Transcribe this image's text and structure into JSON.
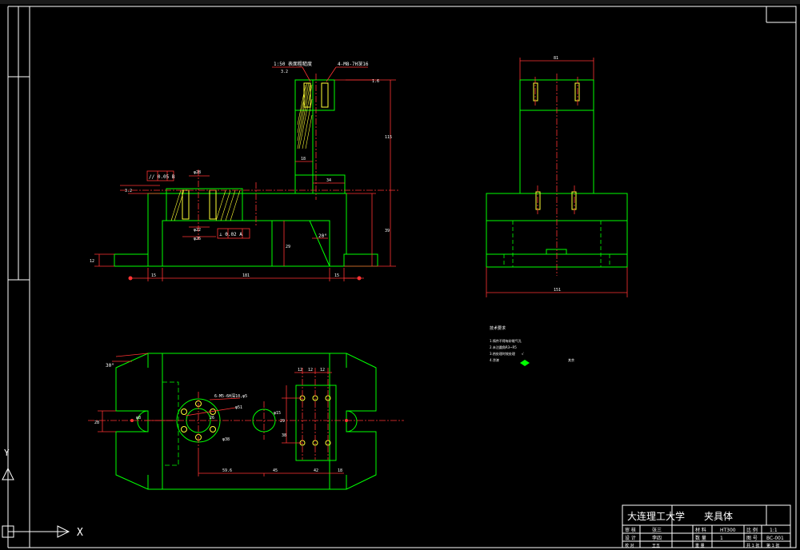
{
  "title_block": {
    "school": "大连理工大学",
    "part_name": "夹具体",
    "row1": [
      "审 核",
      "张三",
      "材 料",
      "HT300",
      "比 例",
      "1:1"
    ],
    "row2": [
      "设 计",
      "李四",
      "数 量",
      "1",
      "图 号",
      "BC-001"
    ],
    "row3": [
      "校 对",
      "王五",
      "重 量",
      "",
      "共 1 张",
      "第 1 张"
    ]
  },
  "front_view": {
    "callout_top_left": "1:50 表面粗糙度",
    "callout_top_right": "4-M8-7H深16",
    "dim_height_total": "115",
    "dim_height_body": "39",
    "dim_width_total": "181",
    "dim_left_ext": "15",
    "dim_right_ext": "15",
    "dim_width_slot": "34",
    "dim_width_col": "18",
    "dim_base_h": "12",
    "dim_bore_top": "φ28",
    "dim_bore_a": "φ22",
    "dim_bore_b": "φ26",
    "dim_inner_h": "29",
    "angle": "20°",
    "tol_parallel": "// 0.05 B",
    "tol_perp": "⊥ 0.02 A",
    "roughness_1": "3.2",
    "roughness_2": "1.6",
    "roughness_3": "3.2"
  },
  "side_view": {
    "dim_top": "81",
    "dim_bottom": "151"
  },
  "top_view": {
    "angle": "30°",
    "hole_callout": "6-M5-6H深10,φ5",
    "dim_pcd": "φ51",
    "dim_bore": "φ38",
    "dim_hole": "φ15",
    "dim_small": "φ8",
    "dim_center_offset": "26",
    "dim_width": "28",
    "dim_a": "59.6",
    "dim_b": "45",
    "dim_c": "42",
    "dim_d": "18",
    "col_dims": [
      "12",
      "12",
      "12"
    ],
    "row_dim": "29",
    "row_dim_right": "38"
  },
  "notes": {
    "heading": "技术要求",
    "items": [
      "1.铸件不得有砂眼气孔",
      "2.未注圆角R3~R5",
      "3.热处理时效处理",
      "4.涂漆"
    ],
    "side_mark": "√",
    "roughness_label": "其余"
  },
  "ucs": {
    "y_label": "Y",
    "x_label": "X"
  },
  "colors": {
    "background": "#000000",
    "outline": "#00ff00",
    "dimension": "#ff3333",
    "text": "#ffffff",
    "hatch": "#ffff00",
    "border": "#ffffff"
  }
}
